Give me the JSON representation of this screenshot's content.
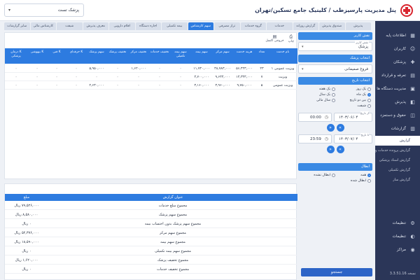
{
  "header": {
    "title": "پنل مدیریت پارسیزطب / کلینیک جامع تسکین/تهران",
    "clinic_select": "پزشک تست"
  },
  "sidebar": {
    "items": [
      {
        "label": "اطلاعات پایه",
        "icon": "grid-icon"
      },
      {
        "label": "کاربران",
        "icon": "users-icon"
      },
      {
        "label": "پزشکان",
        "icon": "doctor-icon"
      },
      {
        "label": "تعرفه و قرارداد",
        "icon": "tariff-icon"
      },
      {
        "label": "مدیریت دستگاه ها",
        "icon": "device-icon"
      },
      {
        "label": "پذیرش",
        "icon": "reception-icon"
      },
      {
        "label": "حقوق و دستمزد",
        "icon": "wallet-icon"
      },
      {
        "label": "گزارشات",
        "icon": "report-icon"
      }
    ],
    "subitems": [
      {
        "label": "گزارش",
        "active": true
      },
      {
        "label": "گزارش پرونده خدمات و bi",
        "active": false
      },
      {
        "label": "گزارش اسناد پزشکی",
        "active": false
      },
      {
        "label": "گزارش تکمیلی",
        "active": false
      },
      {
        "label": "گزارش ساز",
        "active": false
      }
    ],
    "items_bottom": [
      {
        "label": "تنظیمات",
        "icon": "settings-icon"
      },
      {
        "label": "تنظیمات",
        "icon": "toggle-icon"
      },
      {
        "label": "مراکز",
        "icon": "location-icon"
      }
    ],
    "version": "نسخه 3.3.51.16"
  },
  "tabs": [
    {
      "label": "پذیرش",
      "active": false
    },
    {
      "label": "صندوق پذیرش",
      "active": false
    },
    {
      "label": "گزارش روزانه",
      "active": false
    },
    {
      "label": "خدمات",
      "active": false
    },
    {
      "label": "گروه خدمات",
      "active": false
    },
    {
      "label": "تراز مصرفی",
      "active": false
    },
    {
      "label": "سهم کارشناس",
      "active": true
    },
    {
      "label": "بیمه تکمیلی",
      "active": false
    },
    {
      "label": "اجاره دستگاه",
      "active": false
    },
    {
      "label": "اقلام دارویی",
      "active": false
    },
    {
      "label": "معرف پذیرش",
      "active": false
    },
    {
      "label": "شیفت",
      "active": false
    },
    {
      "label": "کارشناس مالی",
      "active": false
    },
    {
      "label": "سایر گزارشات",
      "active": false
    }
  ],
  "filter": {
    "doctor_title": "نقش کاربر",
    "role_label": "نقش کاربر",
    "role_value": "پزشک",
    "doctor_panel_title": "انتخاب پزشک",
    "doctor_value": "فروغ صمیمانی",
    "date_panel_title": "انتخاب تاریخ",
    "date_options": [
      {
        "label": "یک روز",
        "on": false
      },
      {
        "label": "یک هفته",
        "on": false
      },
      {
        "label": "یک ماه",
        "on": true
      },
      {
        "label": "یک سال",
        "on": false
      },
      {
        "label": "بین دو تاریخ",
        "on": false
      },
      {
        "label": "سال مالی",
        "on": false
      },
      {
        "label": "شیفت",
        "on": false
      }
    ],
    "from_label": "از تاریخ",
    "from_date": "۱۴۰۳/۰۶/۰۴",
    "from_time": "00:00",
    "to_label": "تا تاریخ",
    "to_date": "۱۴۰۳/۰۷/۰۴",
    "to_time": "23:59",
    "status_panel_title": "ابطال",
    "status_options": [
      {
        "label": "همه",
        "on": true
      },
      {
        "label": "ابطال نشده",
        "on": false
      },
      {
        "label": "ابطال شده",
        "on": false
      }
    ],
    "search_label": "جستجو"
  },
  "main": {
    "print_label": "چاپ",
    "excel_label": "خروجی اکسل",
    "columns": [
      "نام خدمت",
      "تعداد",
      "هزینه خدمت",
      "سهم مرکز",
      "سهم بیمه",
      "سهم بیمه تکمیلی",
      "تخفیف خدمات",
      "تخفیف مرکز",
      "تخفیف پزشک",
      "سهم پزشک",
      "K حرفه‌ای",
      "K فنی",
      "K بیهوشی",
      "K درمان پزشکی"
    ],
    "rows": [
      [
        "ویزیت عمومی ۱",
        "۲۳",
        "۵۶,۴۴۳,۰۰۰",
        "۳۸,۷۸۳,۰۰۰",
        "۱۱,۷۳۰,۰۰۰",
        "۰",
        "۰",
        "۱,۶۲۰,۰۰۰",
        "۰",
        "۵,۹۵۰,۰۰۰",
        "۰",
        "۰",
        "۰",
        "۰"
      ],
      [
        "ویزیت",
        "۷",
        "۱۳,۳۳۳,۰۰۰",
        "۹,۶۳۳,۰۰۰",
        "۳,۷۰۰,۰۰۰",
        "۰",
        "۰",
        "۰",
        "۰",
        "۰",
        "۰",
        "۰",
        "۰",
        "۰"
      ],
      [
        "ویزیت عمومی",
        "۵",
        "۹,۷۵۰,۰۰۰",
        "۳,۹۶۰,۰۰۰",
        "۳,۱۶۰,۰۰۰",
        "۰",
        "۰",
        "۰",
        "۰",
        "۲,۶۳۰,۰۰۰",
        "۰",
        "۰",
        "۰",
        "۰"
      ]
    ]
  },
  "summary": {
    "title_header": "عنوان گزارش",
    "amount_header": "مبلغ",
    "rows": [
      {
        "title": "مجموع مبلغ خدمات",
        "amount": "۷۹,۵۲۶,۰۰۰ ریال"
      },
      {
        "title": "مجموع سهم پزشک",
        "amount": "۸,۵۸۰,۰۰۰ ریال"
      },
      {
        "title": "مجموع سهم پزشک بدون احتساب بیمه",
        "amount": "۰ ریال"
      },
      {
        "title": "مجموع سهم مرکز",
        "amount": "۵۲,۳۷۶,۰۰۰ ریال"
      },
      {
        "title": "مجموع سهم بیمه",
        "amount": "۱۸,۵۹۰,۰۰۰ ریال"
      },
      {
        "title": "مجموع سهم بیمه تکمیلی",
        "amount": "۰ ریال"
      },
      {
        "title": "مجموع تخفیف پزشک",
        "amount": "۱,۶۲۰,۰۰۰ ریال"
      },
      {
        "title": "مجموع تخفیف خدمات",
        "amount": "۰ ریال"
      }
    ]
  }
}
